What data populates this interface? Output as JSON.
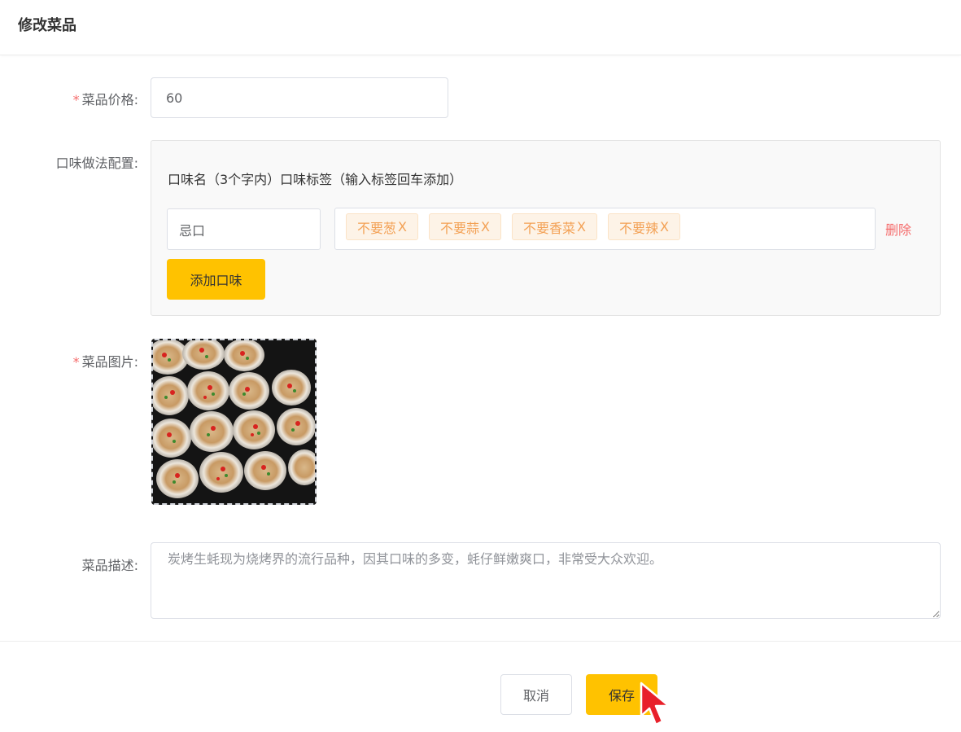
{
  "page": {
    "title": "修改菜品"
  },
  "price": {
    "required_mark": "*",
    "label": "菜品价格:",
    "value": "60"
  },
  "flavor": {
    "label": "口味做法配置:",
    "header": "口味名（3个字内）口味标签（输入标签回车添加）",
    "name_value": "忌口",
    "tags": [
      {
        "text": "不要葱",
        "close": "X"
      },
      {
        "text": "不要蒜",
        "close": "X"
      },
      {
        "text": "不要香菜",
        "close": "X"
      },
      {
        "text": "不要辣",
        "close": "X"
      }
    ],
    "delete_label": "删除",
    "add_label": "添加口味"
  },
  "image": {
    "required_mark": "*",
    "label": "菜品图片:"
  },
  "description": {
    "label": "菜品描述:",
    "value": "炭烤生蚝现为烧烤界的流行品种，因其口味的多变，蚝仔鲜嫩爽口，非常受大众欢迎。"
  },
  "actions": {
    "cancel_label": "取消",
    "save_label": "保存"
  },
  "colors": {
    "accent": "#ffc200",
    "danger": "#f56c6c",
    "tag_text": "#f3a155",
    "tag_bg": "#fdf3e7"
  }
}
